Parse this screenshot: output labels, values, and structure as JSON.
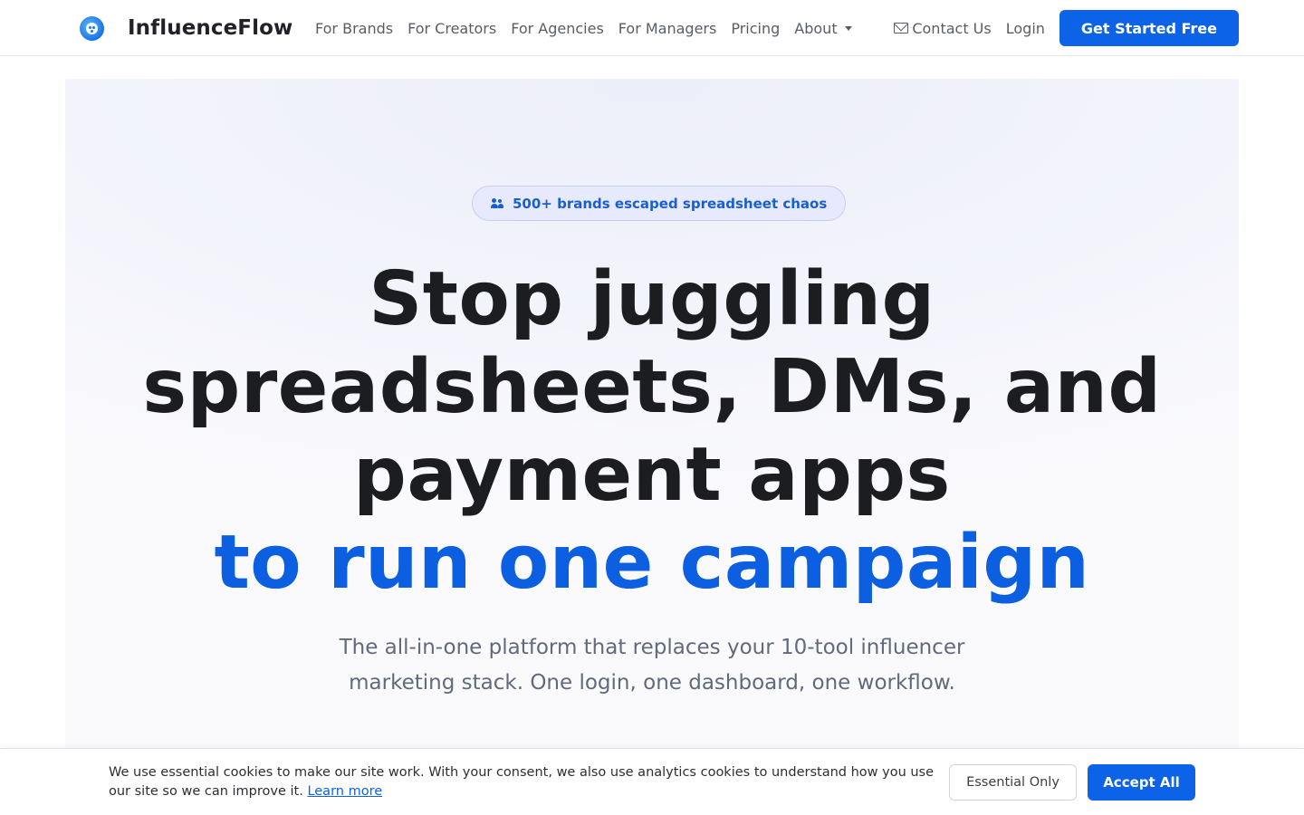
{
  "navbar": {
    "brand_name": "InfluenceFlow",
    "logo_icon": "influenceflow-logo-icon",
    "links": [
      "For Brands",
      "For Creators",
      "For Agencies",
      "For Managers",
      "Pricing",
      "About"
    ],
    "contact_label": "Contact Us",
    "contact_icon": "mail-icon",
    "login_label": "Login",
    "cta_label": "Get Started Free"
  },
  "hero": {
    "badge_icon": "users-icon",
    "badge_text": "500+ brands escaped spreadsheet chaos",
    "headline_lines": [
      "Stop juggling",
      "spreadsheets, DMs, and",
      "payment apps"
    ],
    "headline_accent": "to run one campaign",
    "subtitle": "The all-in-one platform that replaces your 10-tool influencer marketing stack. One login, one dashboard, one workflow."
  },
  "cookie_banner": {
    "text": "We use essential cookies to make our site work. With your consent, we also use analytics cookies to understand how you use our site so we can improve it.",
    "learn_more_label": "Learn more",
    "essential_label": "Essential Only",
    "accept_label": "Accept All"
  },
  "colors": {
    "primary": "#0d63e8",
    "accent_text": "#0b5fe0",
    "heading": "#1b1d21",
    "muted": "#606a7b",
    "badge_bg": "#e7eafc"
  }
}
